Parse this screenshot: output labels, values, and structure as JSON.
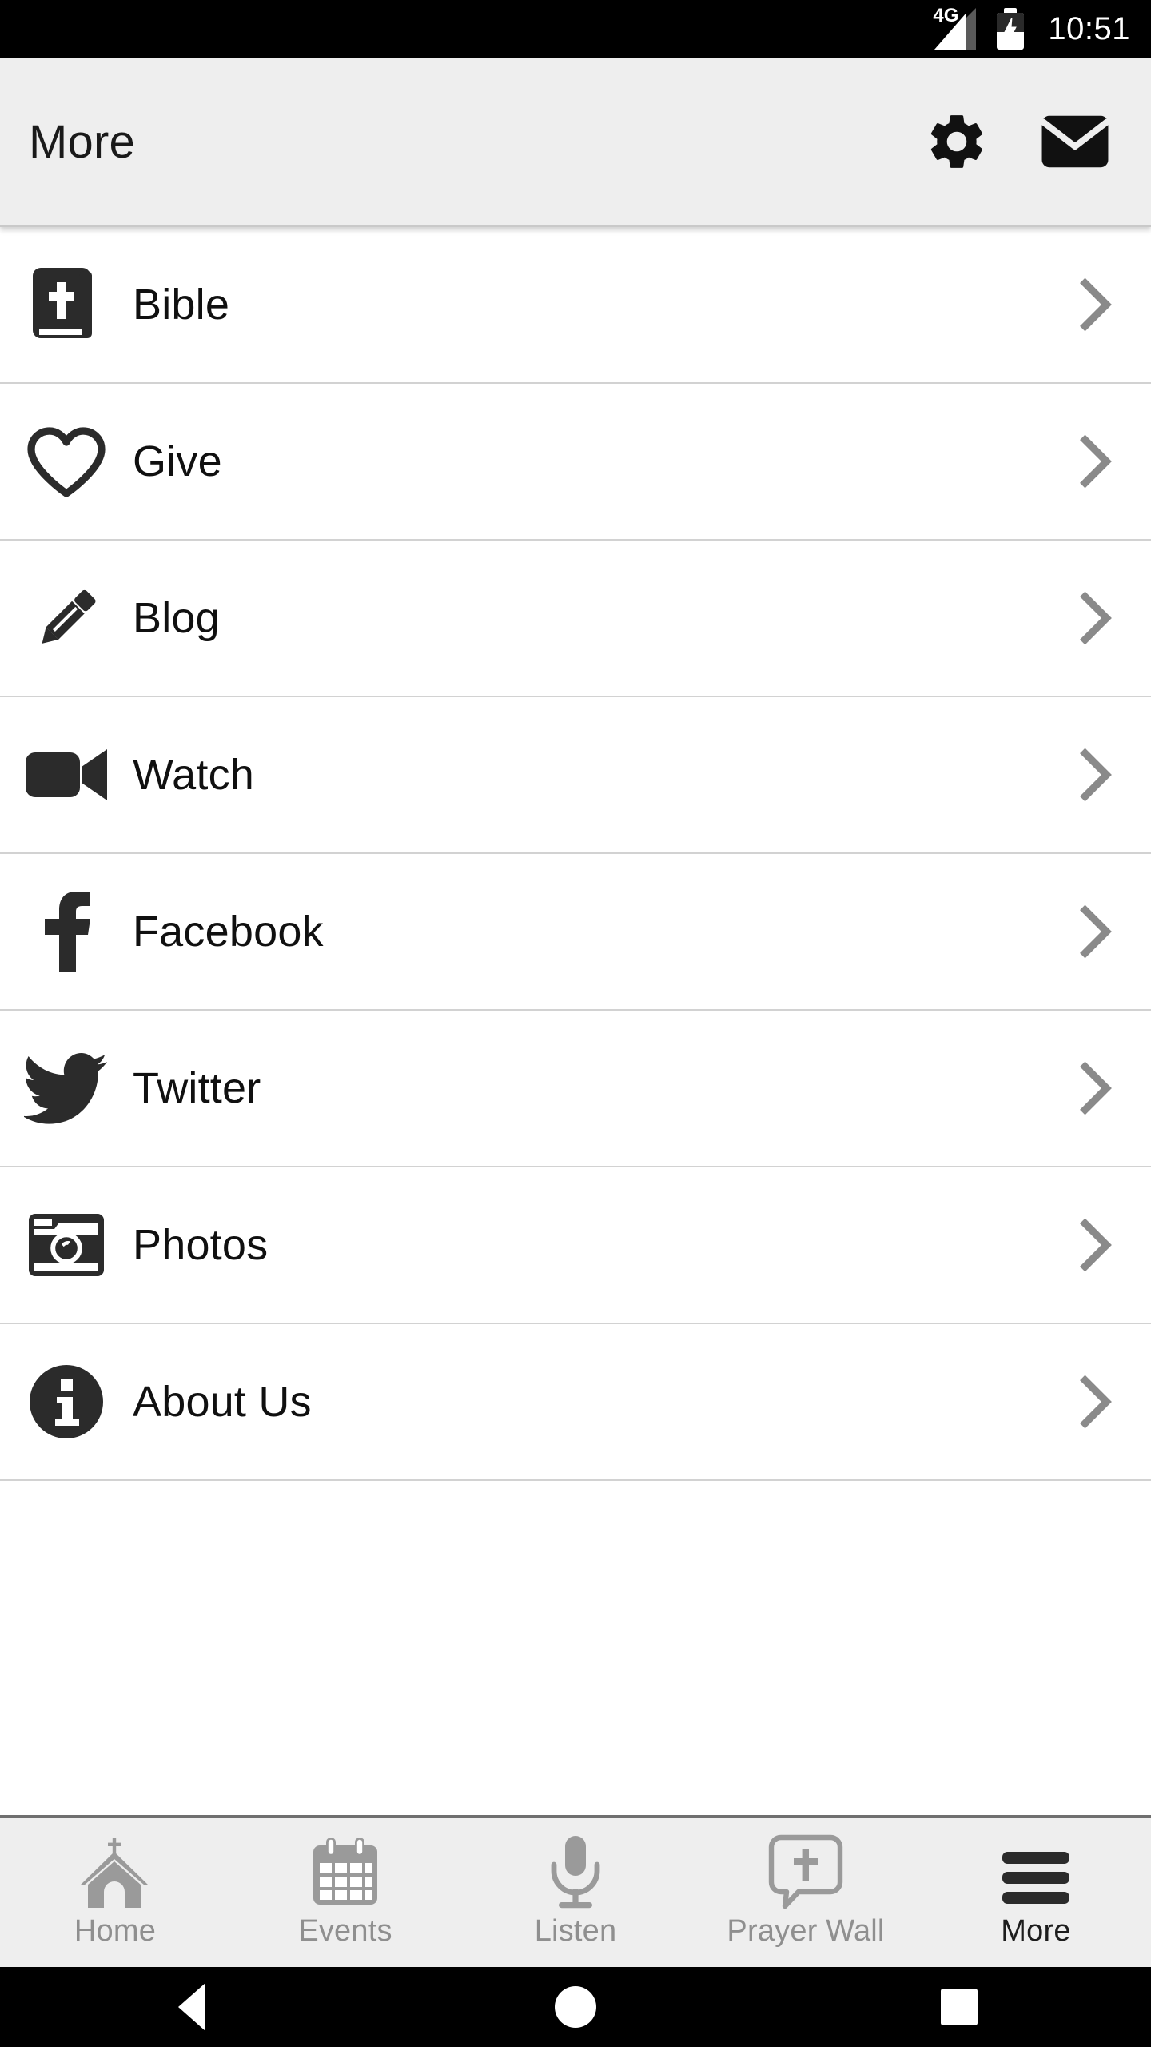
{
  "status_bar": {
    "network_label": "4G",
    "signal_icon": "signal-bars-icon",
    "battery_icon": "battery-charging-icon",
    "time": "10:51"
  },
  "header": {
    "title": "More",
    "actions": [
      {
        "name": "settings-button",
        "icon": "gear-icon"
      },
      {
        "name": "mail-button",
        "icon": "envelope-icon"
      }
    ]
  },
  "menu": {
    "items": [
      {
        "label": "Bible",
        "icon": "bible-book-icon",
        "chevron": "chevron-right-icon"
      },
      {
        "label": "Give",
        "icon": "heart-outline-icon",
        "chevron": "chevron-right-icon"
      },
      {
        "label": "Blog",
        "icon": "pencil-icon",
        "chevron": "chevron-right-icon"
      },
      {
        "label": "Watch",
        "icon": "video-camera-icon",
        "chevron": "chevron-right-icon"
      },
      {
        "label": "Facebook",
        "icon": "facebook-icon",
        "chevron": "chevron-right-icon"
      },
      {
        "label": "Twitter",
        "icon": "twitter-bird-icon",
        "chevron": "chevron-right-icon"
      },
      {
        "label": "Photos",
        "icon": "camera-icon",
        "chevron": "chevron-right-icon"
      },
      {
        "label": "About Us",
        "icon": "info-circle-icon",
        "chevron": "chevron-right-icon"
      }
    ]
  },
  "tab_bar": {
    "items": [
      {
        "label": "Home",
        "icon": "church-icon",
        "active": false
      },
      {
        "label": "Events",
        "icon": "calendar-icon",
        "active": false
      },
      {
        "label": "Listen",
        "icon": "microphone-icon",
        "active": false
      },
      {
        "label": "Prayer Wall",
        "icon": "prayer-bubble-icon",
        "active": false
      },
      {
        "label": "More",
        "icon": "hamburger-icon",
        "active": true
      }
    ]
  },
  "android_nav": {
    "back": "back-triangle-icon",
    "home": "home-circle-icon",
    "recents": "recents-square-icon"
  },
  "colors": {
    "header_bg": "#eeeeee",
    "list_bg": "#ffffff",
    "icon_dark": "#2b2b2b",
    "text_primary": "#101010",
    "divider": "#d2d2d2",
    "tab_inactive": "#8f8f8f",
    "tab_active": "#1d1d1d",
    "chevron": "#8a8a8a"
  }
}
